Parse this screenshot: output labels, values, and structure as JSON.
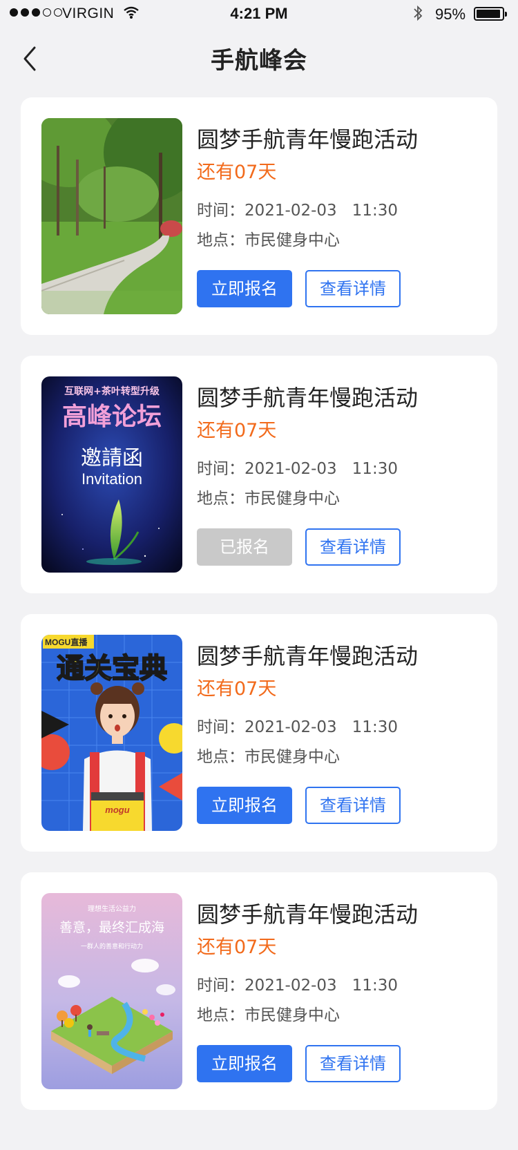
{
  "status_bar": {
    "carrier": "VIRGIN",
    "time": "4:21 PM",
    "battery": "95%"
  },
  "nav": {
    "title": "手航峰会"
  },
  "events": [
    {
      "title": "圆梦手航青年慢跑活动",
      "countdown": "还有07天",
      "time_label": "时间：",
      "date": "2021-02-03",
      "clock": "11:30",
      "place_label": "地点：",
      "place": "市民健身中心",
      "signup_label": "立即报名",
      "signup_state": "open",
      "detail_label": "查看详情",
      "poster": {
        "type": "park-path",
        "text": []
      }
    },
    {
      "title": "圆梦手航青年慢跑活动",
      "countdown": "还有07天",
      "time_label": "时间：",
      "date": "2021-02-03",
      "clock": "11:30",
      "place_label": "地点：",
      "place": "市民健身中心",
      "signup_label": "已报名",
      "signup_state": "registered",
      "detail_label": "查看详情",
      "poster": {
        "type": "forum-invitation",
        "text": [
          "互联网+茶叶转型升级",
          "高峰论坛",
          "邀請函",
          "Invitation"
        ]
      }
    },
    {
      "title": "圆梦手航青年慢跑活动",
      "countdown": "还有07天",
      "time_label": "时间：",
      "date": "2021-02-03",
      "clock": "11:30",
      "place_label": "地点：",
      "place": "市民健身中心",
      "signup_label": "立即报名",
      "signup_state": "open",
      "detail_label": "查看详情",
      "poster": {
        "type": "comic-pop",
        "text": [
          "MOGU直播",
          "通关宝典",
          "mogu"
        ]
      }
    },
    {
      "title": "圆梦手航青年慢跑活动",
      "countdown": "还有07天",
      "time_label": "时间：",
      "date": "2021-02-03",
      "clock": "11:30",
      "place_label": "地点：",
      "place": "市民健身中心",
      "signup_label": "立即报名",
      "signup_state": "open",
      "detail_label": "查看详情",
      "poster": {
        "type": "charity-isometric",
        "text": [
          "理想生活公益力",
          "善意，最终汇成海",
          "一群人的善意和行动力"
        ]
      }
    }
  ],
  "colors": {
    "accent": "#2f73f0",
    "countdown": "#f26a1b",
    "disabled": "#c9c9c9",
    "background": "#f2f2f4"
  },
  "icons": {
    "back": "chevron-left-icon",
    "wifi": "wifi-icon",
    "bluetooth": "bluetooth-icon",
    "battery": "battery-icon"
  }
}
